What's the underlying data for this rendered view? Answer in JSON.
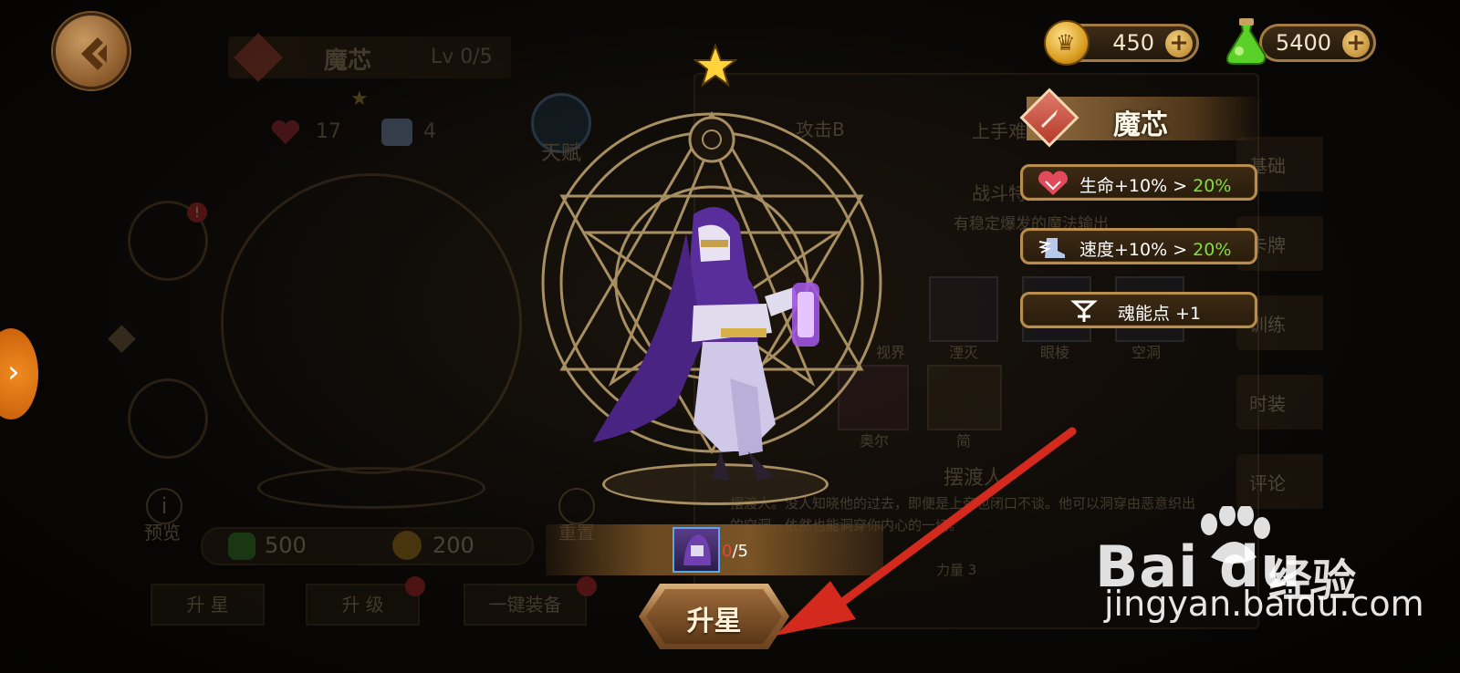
{
  "currency": {
    "gold": "450",
    "potion": "5400",
    "plus": "+"
  },
  "background_panel": {
    "title": "魔芯",
    "level": "Lv 0/5",
    "hp_stat": "17",
    "speed_stat": "4",
    "talent": "天赋",
    "preview": "预览",
    "reset": "重置",
    "cost_potion": "500",
    "cost_gold": "200",
    "tabs": [
      "升 星",
      "升 级",
      "一键装备"
    ],
    "info_attack": "攻击B",
    "info_difficulty": "上手难度",
    "info_battle": "战斗特点",
    "info_desc": "有稳定爆发的魔法输出",
    "info_skills": [
      "视界",
      "湮灭",
      "眼棱",
      "空洞"
    ],
    "info_faces": [
      "奥尔",
      "简"
    ],
    "info_name": "摆渡人",
    "info_story": "摆渡人。没人知晓他的过去，即便是上帝也闭口不谈。他可以洞穿由恶意织出的空洞，依然也能洞穿你内心的一切。",
    "info_attr": "力量 3",
    "right_tabs": [
      "基础",
      "卡牌",
      "训练",
      "时装",
      "评论"
    ]
  },
  "popup": {
    "title": "魔芯",
    "bonuses": [
      {
        "text": "生命+10% > ",
        "highlight": "20%",
        "icon": "heart-icon"
      },
      {
        "text": "速度+10% > ",
        "highlight": "20%",
        "icon": "winged-boot-icon"
      },
      {
        "text": "魂能点 +1",
        "highlight": "",
        "icon": "soul-rune-icon"
      }
    ]
  },
  "star_up": {
    "shard_current": "0",
    "shard_total": "/5",
    "button_label": "升星"
  },
  "colors": {
    "highlight_green": "#7ee03a",
    "shard_red": "#e0483a",
    "arrow_red": "#d42a1e"
  },
  "watermark": {
    "logo": "Bai du",
    "jingyan": "经验",
    "url": "jingyan.baidu.com"
  }
}
